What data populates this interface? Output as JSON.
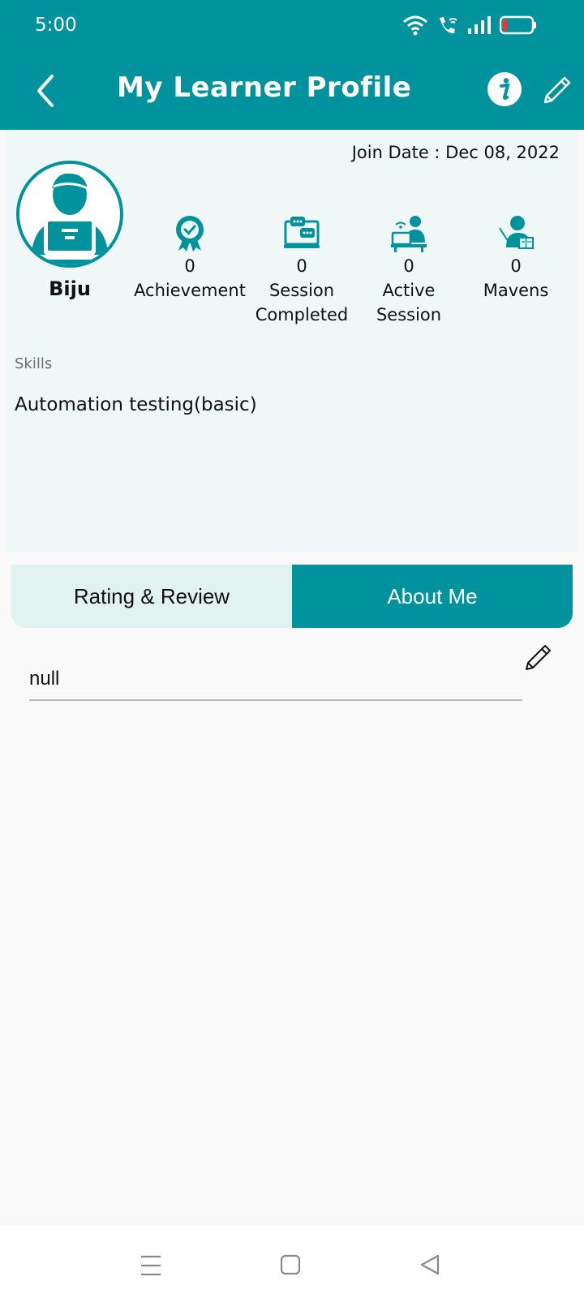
{
  "status_bar": {
    "time": "5:00"
  },
  "header": {
    "title": "My Learner Profile"
  },
  "profile": {
    "join_date": "Join Date : Dec 08, 2022",
    "name": "Biju",
    "stats": [
      {
        "value": "0",
        "label_line1": "Achievement",
        "label_line2": "",
        "icon": "award-icon"
      },
      {
        "value": "0",
        "label_line1": "Session",
        "label_line2": "Completed",
        "icon": "chat-monitor-icon"
      },
      {
        "value": "0",
        "label_line1": "Active",
        "label_line2": "Session",
        "icon": "desk-person-icon"
      },
      {
        "value": "0",
        "label_line1": "Mavens",
        "label_line2": "",
        "icon": "teacher-icon"
      }
    ],
    "skills_label": "Skills",
    "skills_value": "Automation testing(basic)"
  },
  "tabs": [
    {
      "label": "Rating & Review",
      "active": false
    },
    {
      "label": "About Me",
      "active": true
    }
  ],
  "about": {
    "text": "null"
  },
  "colors": {
    "primary": "#00939d",
    "card_bg": "#eff7f7",
    "tab_inactive_bg": "#e1f2f0"
  }
}
